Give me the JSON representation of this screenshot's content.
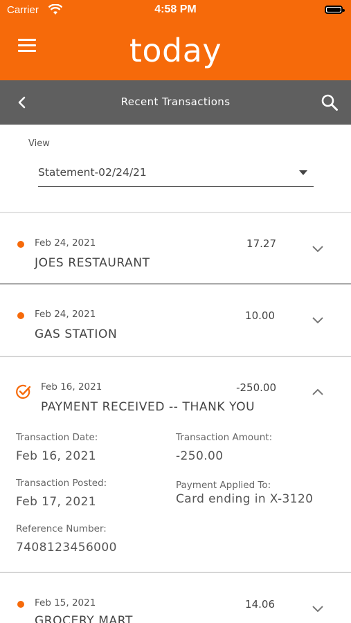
{
  "status_bar": {
    "carrier": "Carrier",
    "time": "4:58 PM"
  },
  "header": {
    "logo_text": "today"
  },
  "title_bar": {
    "title": "Recent Transactions"
  },
  "view": {
    "label": "View",
    "selected": "Statement-02/24/21"
  },
  "transactions": [
    {
      "date": "Feb 24, 2021",
      "merchant": "JOES RESTAURANT",
      "amount": "17.27",
      "expanded": false
    },
    {
      "date": "Feb 24, 2021",
      "merchant": "GAS STATION",
      "amount": "10.00",
      "expanded": false
    },
    {
      "date": "Feb 16, 2021",
      "merchant": "PAYMENT RECEIVED -- THANK YOU",
      "amount": "-250.00",
      "expanded": true,
      "details": {
        "transaction_date_label": "Transaction Date:",
        "transaction_date": "Feb 16, 2021",
        "transaction_amount_label": "Transaction Amount:",
        "transaction_amount": "-250.00",
        "transaction_posted_label": "Transaction Posted:",
        "transaction_posted": "Feb 17, 2021",
        "payment_applied_label": "Payment Applied To:",
        "payment_applied": "Card ending in X-3120",
        "reference_label": "Reference Number:",
        "reference": "7408123456000"
      }
    },
    {
      "date": "Feb 15, 2021",
      "merchant": "GROCERY MART",
      "amount": "14.06",
      "expanded": false
    }
  ],
  "colors": {
    "brand": "#f66a0a",
    "title_bar": "#5f5f5f"
  },
  "icons": [
    "hamburger-icon",
    "back-chevron-icon",
    "search-icon",
    "dropdown-caret-icon",
    "chevron-down-icon",
    "chevron-up-icon",
    "payment-check-icon",
    "pending-dot-icon",
    "wifi-icon",
    "battery-icon"
  ]
}
